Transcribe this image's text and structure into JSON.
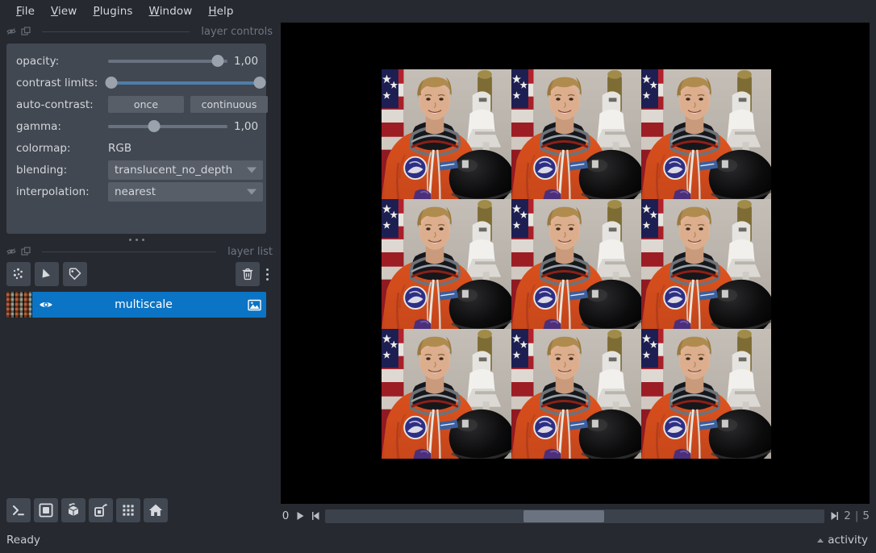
{
  "menubar": {
    "items": [
      {
        "label": "File",
        "accel": "F"
      },
      {
        "label": "View",
        "accel": "V"
      },
      {
        "label": "Plugins",
        "accel": "P"
      },
      {
        "label": "Window",
        "accel": "W"
      },
      {
        "label": "Help",
        "accel": "H"
      }
    ]
  },
  "layer_controls": {
    "dock_title": "layer controls",
    "rows": {
      "opacity": {
        "label": "opacity:",
        "value": "1,00",
        "fraction": 0.92
      },
      "contrast_limits": {
        "label": "contrast limits:",
        "low_fraction": 0.02,
        "high_fraction": 0.98
      },
      "auto_contrast": {
        "label": "auto-contrast:",
        "once": "once",
        "continuous": "continuous"
      },
      "gamma": {
        "label": "gamma:",
        "value": "1,00",
        "fraction": 0.385
      },
      "colormap": {
        "label": "colormap:",
        "value": "RGB"
      },
      "blending": {
        "label": "blending:",
        "value": "translucent_no_depth"
      },
      "interpolation": {
        "label": "interpolation:",
        "value": "nearest"
      }
    }
  },
  "layer_list": {
    "dock_title": "layer list",
    "toolbar": [
      {
        "name": "new-points-layer",
        "icon": "points-icon"
      },
      {
        "name": "new-shapes-layer",
        "icon": "shapes-icon"
      },
      {
        "name": "new-labels-layer",
        "icon": "labels-icon"
      }
    ],
    "delete_icon": "trash-icon",
    "menu_icon": "kebab-menu-icon",
    "layers": [
      {
        "name": "multiscale",
        "visible": true,
        "type_icon": "image-layer-icon",
        "selected": true
      }
    ]
  },
  "viewer_buttons": [
    {
      "name": "console-button",
      "icon": "console-icon"
    },
    {
      "name": "ndisplay-toggle-button",
      "icon": "square-2d-icon"
    },
    {
      "name": "roll-dims-button",
      "icon": "cube-roll-icon"
    },
    {
      "name": "transpose-dims-button",
      "icon": "transpose-icon"
    },
    {
      "name": "grid-view-button",
      "icon": "grid-icon"
    },
    {
      "name": "home-button",
      "icon": "home-icon"
    }
  ],
  "status": {
    "text": "Ready",
    "activity_label": "activity"
  },
  "dims": {
    "axis_label": "0",
    "play_icon": "play-icon",
    "step_left_icon": "step-left-icon",
    "step_right_icon": "step-right-icon",
    "current": "2",
    "separator": "|",
    "max": "5",
    "handle_left_fraction": 0.397,
    "handle_width_fraction": 0.162
  },
  "canvas": {
    "grid_rows": 3,
    "grid_cols": 3,
    "tiles": [
      {
        "id": "tile-0-0"
      },
      {
        "id": "tile-0-1"
      },
      {
        "id": "tile-0-2"
      },
      {
        "id": "tile-1-0"
      },
      {
        "id": "tile-1-1"
      },
      {
        "id": "tile-1-2"
      },
      {
        "id": "tile-2-0"
      },
      {
        "id": "tile-2-1"
      },
      {
        "id": "tile-2-2"
      }
    ],
    "background": "#000000"
  },
  "theme": {
    "background": "#262930",
    "panel": "#414851",
    "control": "#575e68",
    "text": "#d4d6da",
    "muted_text": "#6f7680",
    "highlight": "#0b74c4",
    "slider_track": "#6a7280",
    "slider_knob": "#9aa2ad"
  }
}
